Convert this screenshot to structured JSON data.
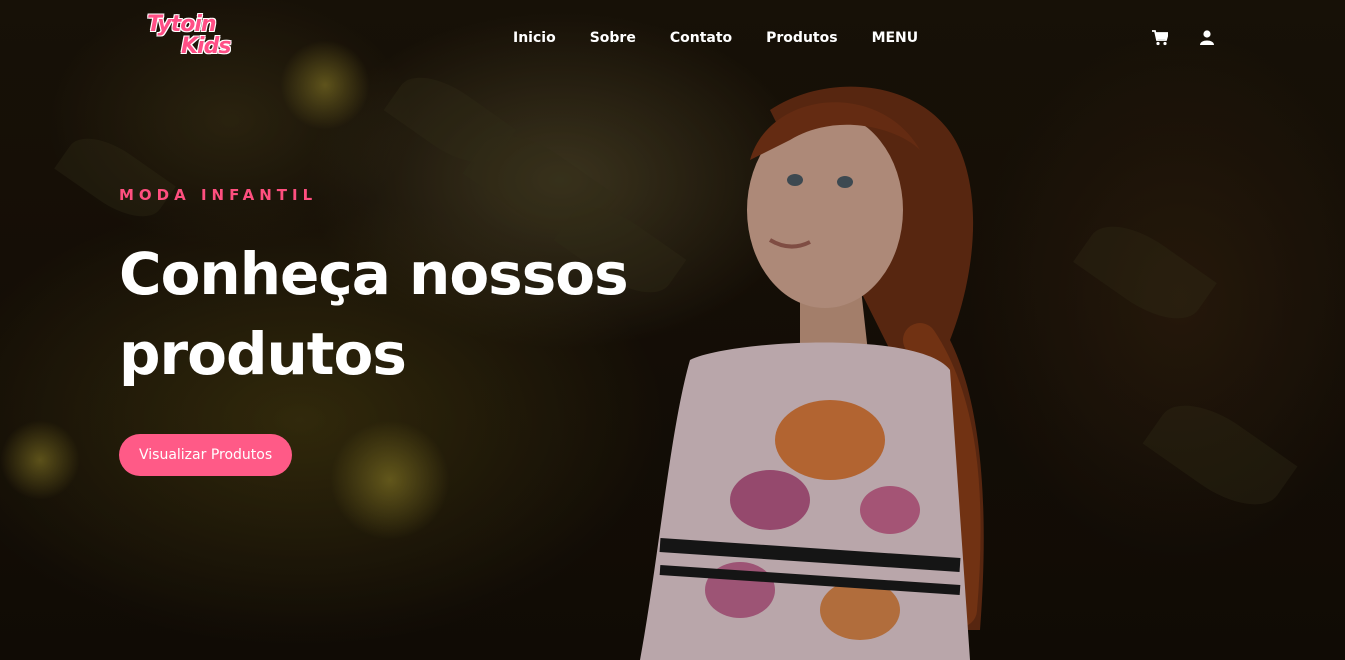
{
  "brand": {
    "logo_line1": "Tytoin",
    "logo_line2": "Kids",
    "accent_color": "#ff5a87"
  },
  "nav": {
    "items": [
      {
        "label": "Inicio"
      },
      {
        "label": "Sobre"
      },
      {
        "label": "Contato"
      },
      {
        "label": "Produtos"
      },
      {
        "label": "MENU"
      }
    ],
    "icons": [
      "cart-icon",
      "user-icon"
    ]
  },
  "hero": {
    "eyebrow": "MODA INFANTIL",
    "headline_line1": "Conheça nossos",
    "headline_line2": "produtos",
    "cta_label": "Visualizar Produtos",
    "background": "photo-girl-in-floral-dress"
  }
}
